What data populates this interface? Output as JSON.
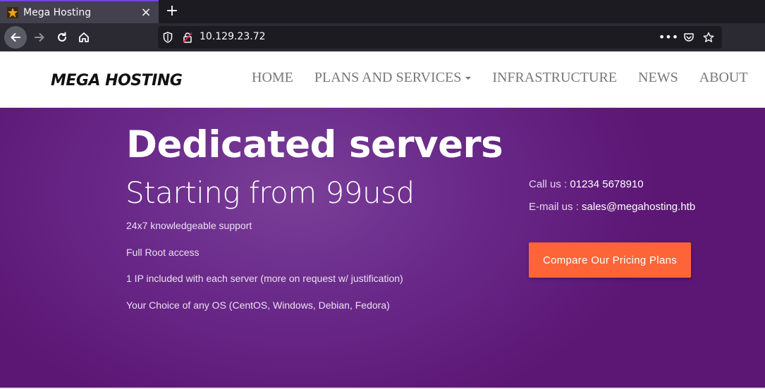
{
  "browser": {
    "tab_title": "Mega Hosting",
    "tab_favicon": "star-favicon-icon",
    "close_glyph": "×",
    "new_tab_glyph": "+",
    "url": "10.129.23.72",
    "more_glyph": "•••"
  },
  "site": {
    "logo": "MEGA HOSTING",
    "menu": [
      "HOME",
      "PLANS AND SERVICES",
      "INFRASTRUCTURE",
      "NEWS",
      "ABOUT"
    ]
  },
  "hero": {
    "title": "Dedicated servers",
    "subtitle": "Starting from 99usd",
    "features": [
      "24x7 knowledgeable support",
      "Full Root access",
      "1 IP included with each server (more on request w/ justification)",
      "Your Choice of any OS (CentOS, Windows, Debian, Fedora)"
    ],
    "call_label": "Call us : ",
    "call_value": "01234 5678910",
    "email_label": "E-mail us : ",
    "email_value": "sales@megahosting.htb",
    "cta_label": "Compare Our Pricing Plans"
  },
  "colors": {
    "accent": "#fd6539",
    "hero_purple": "#6a2a8a",
    "browser_dark": "#1c1b22"
  }
}
